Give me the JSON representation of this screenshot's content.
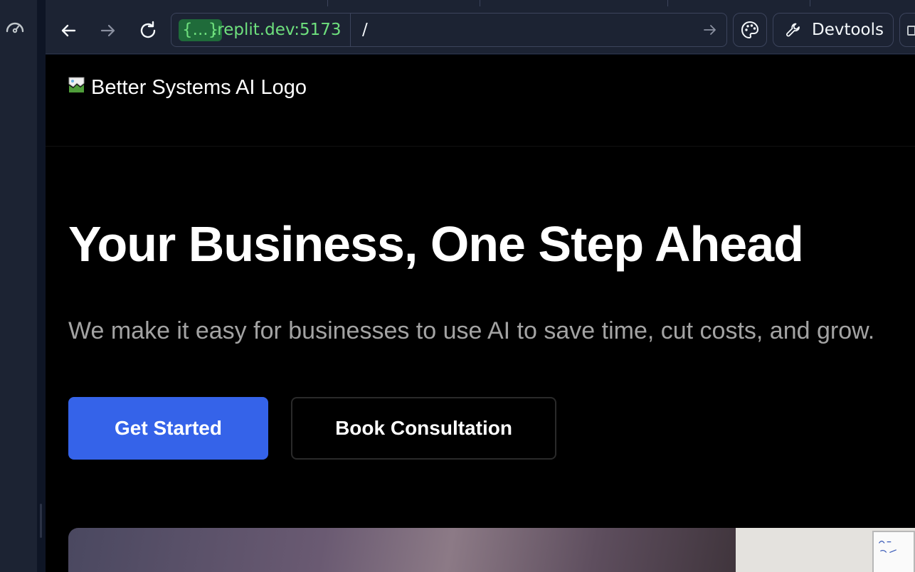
{
  "browser": {
    "url_host_placeholder": "{...}",
    "url_host": ".replit.dev:5173",
    "url_path": "/",
    "devtools_label": "Devtools"
  },
  "site": {
    "logo_alt": "Better Systems AI Logo",
    "hero_title": "Your Business, One Step Ahead",
    "hero_subtitle": "We make it easy for businesses to use AI to save time, cut costs, and grow.",
    "primary_cta": "Get Started",
    "secondary_cta": "Book Consultation"
  },
  "colors": {
    "accent": "#3563e9",
    "host_green": "#6ee07d",
    "page_bg": "#000000",
    "ide_bg": "#1c2333"
  },
  "icons": {
    "rail": "gauge-icon",
    "back": "arrow-left-icon",
    "forward": "arrow-right-icon",
    "reload": "reload-icon",
    "go": "arrow-right-icon",
    "theme": "palette-icon",
    "devtools": "wrench-icon",
    "more": "panel-icon",
    "logo": "broken-image-icon"
  }
}
